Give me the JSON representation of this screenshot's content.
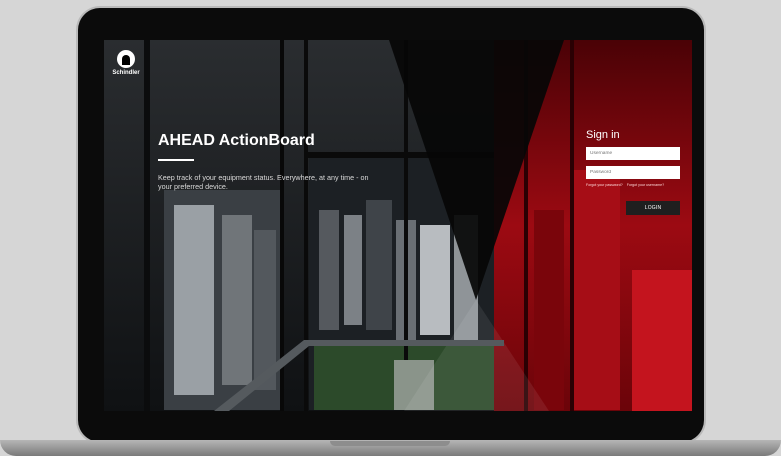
{
  "brand": {
    "name": "Schindler"
  },
  "hero": {
    "title": "AHEAD ActionBoard",
    "tagline": "Keep track of your equipment status. Everywhere, at any time - on your preferred device."
  },
  "signin": {
    "title": "Sign in",
    "username_placeholder": "Username",
    "password_placeholder": "Password",
    "forgot_password": "Forgot your password?",
    "forgot_username": "Forgot your username?",
    "login_label": "LOGIN"
  },
  "colors": {
    "accent_red": "#c8121a",
    "dark": "#101214"
  }
}
